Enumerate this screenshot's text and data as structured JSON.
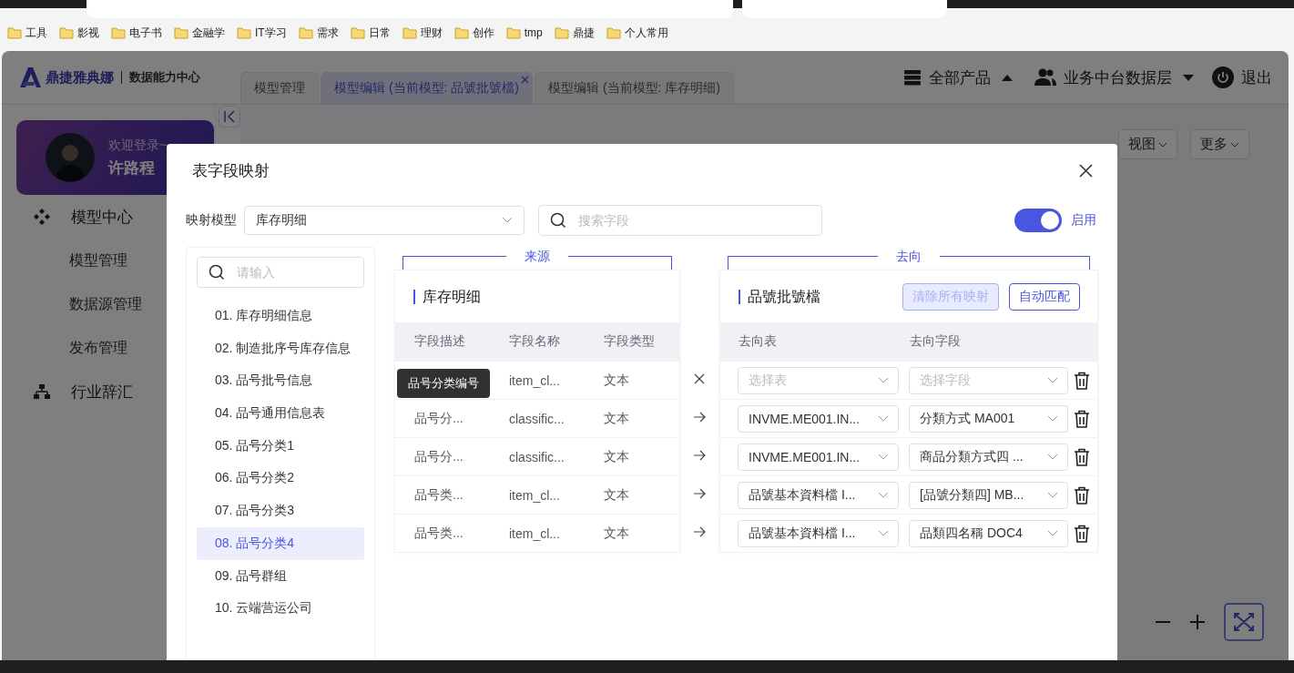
{
  "bookmarks": [
    "工具",
    "影视",
    "电子书",
    "金融学",
    "IT学习",
    "需求",
    "日常",
    "理财",
    "创作",
    "tmp",
    "鼎捷",
    "个人常用"
  ],
  "brand": {
    "name": "鼎捷雅典娜",
    "subtitle": "数据能力中心"
  },
  "tabs": [
    {
      "label": "模型管理",
      "selected": false,
      "closable": false
    },
    {
      "label": "模型编辑 (当前模型: 品號批號檔)",
      "selected": true,
      "closable": true
    },
    {
      "label": "模型编辑 (当前模型: 库存明细)",
      "selected": false,
      "closable": false
    }
  ],
  "header_menu": {
    "products": "全部产品",
    "workspace": "业务中台数据层",
    "logout": "退出"
  },
  "user_card": {
    "greeting": "欢迎登录~",
    "name": "许路程"
  },
  "sidebar": {
    "items": [
      {
        "label": "模型中心",
        "children": [
          {
            "label": "模型管理"
          },
          {
            "label": "数据源管理"
          },
          {
            "label": "发布管理"
          }
        ]
      },
      {
        "label": "行业辞汇"
      }
    ]
  },
  "toolbar": [
    "视图",
    "更多"
  ],
  "dialog": {
    "title": "表字段映射",
    "model_label": "映射模型",
    "model_value": "库存明细",
    "field_search": {
      "placeholder": "搜索字段"
    },
    "enabled": {
      "label": "启用",
      "on": true
    },
    "table_search": {
      "placeholder": "请输入"
    },
    "tables": [
      {
        "label": "01. 库存明细信息",
        "selected": false
      },
      {
        "label": "02. 制造批序号库存信息",
        "selected": false
      },
      {
        "label": "03. 品号批号信息",
        "selected": false
      },
      {
        "label": "04. 品号通用信息表",
        "selected": false
      },
      {
        "label": "05. 品号分类1",
        "selected": false
      },
      {
        "label": "06. 品号分类2",
        "selected": false
      },
      {
        "label": "07. 品号分类3",
        "selected": false
      },
      {
        "label": "08. 品号分类4",
        "selected": true
      },
      {
        "label": "09. 品号群组",
        "selected": false
      },
      {
        "label": "10. 云端营运公司",
        "selected": false
      }
    ],
    "source": {
      "legend": "来源",
      "title": "库存明细",
      "columns": [
        "字段描述",
        "字段名称",
        "字段类型"
      ]
    },
    "target": {
      "legend": "去向",
      "title": "品號批號檔",
      "buttons": [
        {
          "label": "清除所有映射",
          "disabled": true
        },
        {
          "label": "自动匹配",
          "disabled": false
        }
      ],
      "columns": [
        "去向表",
        "去向字段"
      ]
    },
    "rows": [
      {
        "source": {
          "name": "item_cl...",
          "type": "文本"
        },
        "mapped": false,
        "table": {
          "placeholder": "选择表"
        },
        "field": {
          "placeholder": "选择字段"
        }
      },
      {
        "source": {
          "desc": "品号分...",
          "name": "classific...",
          "type": "文本"
        },
        "mapped": true,
        "table": {
          "value": "INVME.ME001.IN..."
        },
        "field": {
          "value": "分類方式 MA001"
        }
      },
      {
        "source": {
          "desc": "品号分...",
          "name": "classific...",
          "type": "文本"
        },
        "mapped": true,
        "table": {
          "value": "INVME.ME001.IN..."
        },
        "field": {
          "value": "商品分類方式四 ..."
        }
      },
      {
        "source": {
          "desc": "品号类...",
          "name": "item_cl...",
          "type": "文本"
        },
        "mapped": true,
        "table": {
          "value": "品號基本資料檔 I..."
        },
        "field": {
          "value": "[品號分類四] MB..."
        }
      },
      {
        "source": {
          "desc": "品号类...",
          "name": "item_cl...",
          "type": "文本"
        },
        "mapped": true,
        "table": {
          "value": "品號基本資料檔 I..."
        },
        "field": {
          "value": "品類四名稱 DOC4"
        }
      }
    ],
    "tooltip": "品号分类编号"
  }
}
